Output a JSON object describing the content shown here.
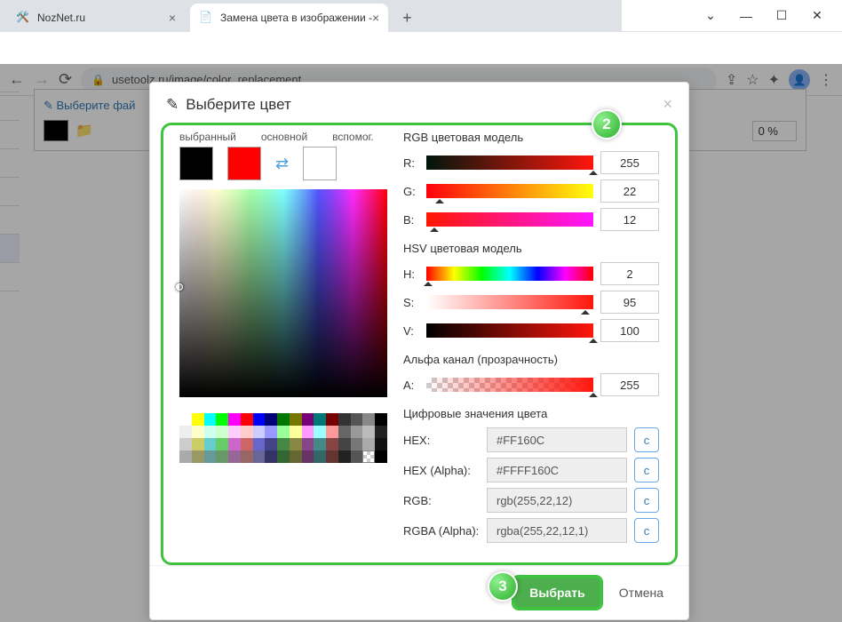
{
  "tabs": {
    "t1": "NozNet.ru",
    "t2": "Замена цвета в изображении -"
  },
  "url": "usetoolz.ru/image/color_replacement",
  "bg": {
    "choose_file": "✎ Выберите фай",
    "zoom": "0 %"
  },
  "modal": {
    "title": "Выберите цвет",
    "labels": {
      "selected": "выбранный",
      "main": "основной",
      "aux": "вспомог."
    },
    "rgb_title": "RGB цветовая модель",
    "hsv_title": "HSV цветовая модель",
    "alpha_title": "Альфа канал (прозрачность)",
    "digital_title": "Цифровые значения цвета",
    "R": "R:",
    "G": "G:",
    "B": "B:",
    "H": "H:",
    "S": "S:",
    "V": "V:",
    "A": "A:",
    "r_val": "255",
    "g_val": "22",
    "b_val": "12",
    "h_val": "2",
    "s_val": "95",
    "v_val": "100",
    "a_val": "255",
    "hex_label": "HEX:",
    "hexa_label": "HEX (Alpha):",
    "rgb_label": "RGB:",
    "rgba_label": "RGBA (Alpha):",
    "hex_val": "#FF160C",
    "hexa_val": "#FFFF160C",
    "rgb_val": "rgb(255,22,12)",
    "rgba_val": "rgba(255,22,12,1)",
    "copy": "c",
    "ok": "Выбрать",
    "cancel": "Отмена",
    "badge2": "2",
    "badge3": "3"
  },
  "colors": {
    "selected": "#000000",
    "main": "#ff0000",
    "aux": "#ffffff"
  }
}
